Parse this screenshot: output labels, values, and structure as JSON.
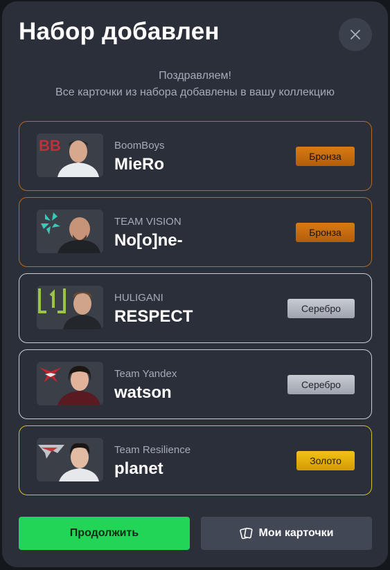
{
  "modal": {
    "title": "Набор добавлен",
    "subtitle_line1": "Поздравляем!",
    "subtitle_line2": "Все карточки из набора добавлены в вашу коллекцию"
  },
  "cards": [
    {
      "team": "BoomBoys",
      "player": "MieRo",
      "rarity": "Бронза",
      "tier": "bronze",
      "team_logo": "boomboys-logo"
    },
    {
      "team": "TEAM VISION",
      "player": "No[o]ne-",
      "rarity": "Бронза",
      "tier": "bronze",
      "team_logo": "team-vision-logo"
    },
    {
      "team": "HULIGANI",
      "player": "RESPECT",
      "rarity": "Серебро",
      "tier": "silver",
      "team_logo": "huligani-logo"
    },
    {
      "team": "Team Yandex",
      "player": "watson",
      "rarity": "Серебро",
      "tier": "silver",
      "team_logo": "team-yandex-logo"
    },
    {
      "team": "Team Resilience",
      "player": "planet",
      "rarity": "Золото",
      "tier": "gold",
      "team_logo": "team-resilience-logo"
    }
  ],
  "buttons": {
    "continue_label": "Продолжить",
    "my_cards_label": "Мои карточки",
    "my_cards_icon": "cards-icon",
    "close_icon": "close-icon"
  },
  "colors": {
    "modal_bg": "#2b2f3a",
    "continue_green": "#23d557",
    "bronze": "#d97b13",
    "silver": "#c8ccd3",
    "gold": "#f2c214"
  }
}
